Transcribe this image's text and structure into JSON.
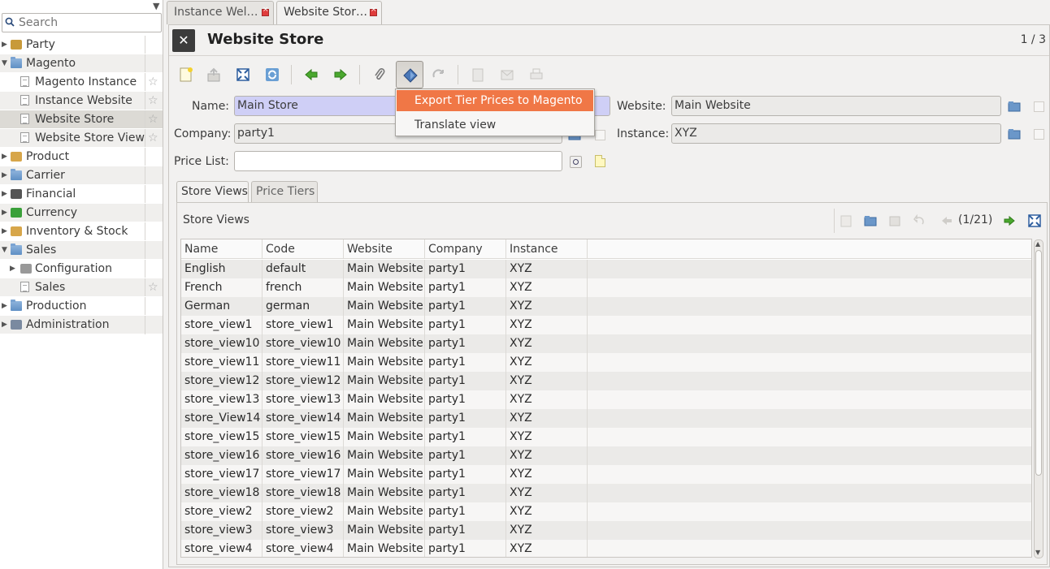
{
  "sidebar": {
    "search_placeholder": "Search",
    "items": [
      {
        "label": "Party",
        "icon": "party-icon",
        "expander": "▶"
      },
      {
        "label": "Magento",
        "icon": "folder-icon",
        "expander": "▼"
      },
      {
        "label": "Magento Instance",
        "icon": "document-icon",
        "expander": ""
      },
      {
        "label": "Instance Website",
        "icon": "document-icon",
        "expander": ""
      },
      {
        "label": "Website Store",
        "icon": "document-icon",
        "expander": ""
      },
      {
        "label": "Website Store View",
        "icon": "document-icon",
        "expander": ""
      },
      {
        "label": "Product",
        "icon": "product-icon",
        "expander": "▶"
      },
      {
        "label": "Carrier",
        "icon": "folder-icon",
        "expander": "▶"
      },
      {
        "label": "Financial",
        "icon": "calculator-icon",
        "expander": "▶"
      },
      {
        "label": "Currency",
        "icon": "currency-icon",
        "expander": "▶"
      },
      {
        "label": "Inventory & Stock",
        "icon": "inventory-icon",
        "expander": "▶"
      },
      {
        "label": "Sales",
        "icon": "folder-icon",
        "expander": "▼"
      },
      {
        "label": "Configuration",
        "icon": "configuration-icon",
        "expander": "▶"
      },
      {
        "label": "Sales",
        "icon": "document-icon",
        "expander": ""
      },
      {
        "label": "Production",
        "icon": "folder-icon",
        "expander": "▶"
      },
      {
        "label": "Administration",
        "icon": "tools-icon",
        "expander": "▶"
      }
    ]
  },
  "tabs": [
    {
      "label": "Instance Wel…"
    },
    {
      "label": "Website Stor…"
    }
  ],
  "header": {
    "title": "Website Store",
    "record_count": "1 / 3"
  },
  "form": {
    "name_label": "Name:",
    "name_value": "Main Store",
    "company_label": "Company:",
    "company_value": "party1",
    "pricelist_label": "Price List:",
    "pricelist_value": "",
    "website_label": "Website:",
    "website_value": "Main Website",
    "instance_label": "Instance:",
    "instance_value": "XYZ"
  },
  "popup": {
    "items": [
      {
        "label": "Export Tier Prices to Magento",
        "highlighted": true
      },
      {
        "label": "Translate view",
        "highlighted": false
      }
    ]
  },
  "subtabs": [
    {
      "label": "Store Views"
    },
    {
      "label": "Price Tiers"
    }
  ],
  "store_views": {
    "header": "Store Views",
    "pagination": "(1/21)",
    "columns": [
      "Name",
      "Code",
      "Website",
      "Company",
      "Instance"
    ],
    "rows": [
      [
        "English",
        "default",
        "Main Website",
        "party1",
        "XYZ"
      ],
      [
        "French",
        "french",
        "Main Website",
        "party1",
        "XYZ"
      ],
      [
        "German",
        "german",
        "Main Website",
        "party1",
        "XYZ"
      ],
      [
        "store_view1",
        "store_view1",
        "Main Website",
        "party1",
        "XYZ"
      ],
      [
        "store_view10",
        "store_view10",
        "Main Website",
        "party1",
        "XYZ"
      ],
      [
        "store_view11",
        "store_view11",
        "Main Website",
        "party1",
        "XYZ"
      ],
      [
        "store_view12",
        "store_view12",
        "Main Website",
        "party1",
        "XYZ"
      ],
      [
        "store_view13",
        "store_view13",
        "Main Website",
        "party1",
        "XYZ"
      ],
      [
        "store_View14",
        "store_view14",
        "Main Website",
        "party1",
        "XYZ"
      ],
      [
        "store_view15",
        "store_view15",
        "Main Website",
        "party1",
        "XYZ"
      ],
      [
        "store_view16",
        "store_view16",
        "Main Website",
        "party1",
        "XYZ"
      ],
      [
        "store_view17",
        "store_view17",
        "Main Website",
        "party1",
        "XYZ"
      ],
      [
        "store_view18",
        "store_view18",
        "Main Website",
        "party1",
        "XYZ"
      ],
      [
        "store_view2",
        "store_view2",
        "Main Website",
        "party1",
        "XYZ"
      ],
      [
        "store_view3",
        "store_view3",
        "Main Website",
        "party1",
        "XYZ"
      ],
      [
        "store_view4",
        "store_view4",
        "Main Website",
        "party1",
        "XYZ"
      ]
    ]
  },
  "colors": {
    "required_field": "#cfcff6",
    "menu_highlight": "#f07746",
    "selected_row": "#dcdad5"
  }
}
